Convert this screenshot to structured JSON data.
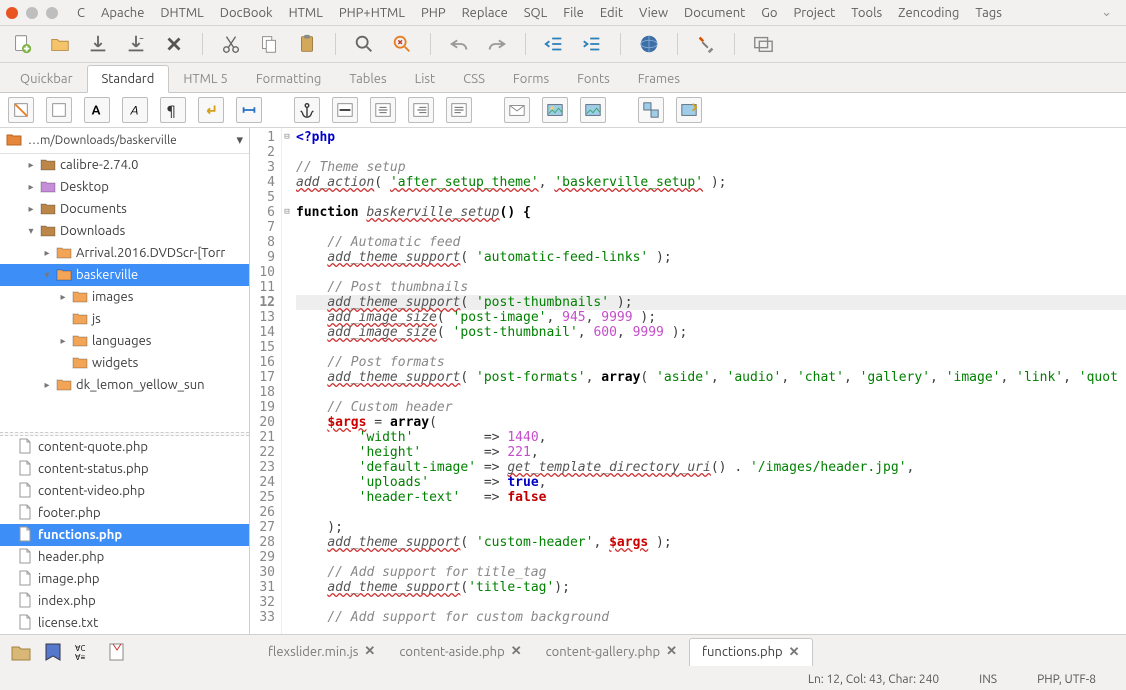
{
  "menu": [
    "C",
    "Apache",
    "DHTML",
    "DocBook",
    "HTML",
    "PHP+HTML",
    "PHP",
    "Replace",
    "SQL",
    "File",
    "Edit",
    "View",
    "Document",
    "Go",
    "Project",
    "Tools",
    "Zencoding",
    "Tags"
  ],
  "toolbar_tabs": [
    "Quickbar",
    "Standard",
    "HTML 5",
    "Formatting",
    "Tables",
    "List",
    "CSS",
    "Forms",
    "Fonts",
    "Frames"
  ],
  "active_toolbar_tab": 1,
  "sidebar": {
    "path": "…m/Downloads/baskerville",
    "tree": [
      {
        "indent": 1,
        "expander": "▸",
        "icon": "folder-brown",
        "label": "calibre-2.74.0"
      },
      {
        "indent": 1,
        "expander": "▸",
        "icon": "folder-purple",
        "label": "Desktop"
      },
      {
        "indent": 1,
        "expander": "▸",
        "icon": "folder-brown",
        "label": "Documents"
      },
      {
        "indent": 1,
        "expander": "▾",
        "icon": "folder-brown",
        "label": "Downloads"
      },
      {
        "indent": 2,
        "expander": "▸",
        "icon": "folder",
        "label": "Arrival.2016.DVDScr-[Torr"
      },
      {
        "indent": 2,
        "expander": "▾",
        "icon": "folder",
        "label": "baskerville",
        "selected": true
      },
      {
        "indent": 3,
        "expander": "▸",
        "icon": "folder",
        "label": "images"
      },
      {
        "indent": 3,
        "expander": "",
        "icon": "folder",
        "label": "js"
      },
      {
        "indent": 3,
        "expander": "▸",
        "icon": "folder",
        "label": "languages"
      },
      {
        "indent": 3,
        "expander": "",
        "icon": "folder",
        "label": "widgets"
      },
      {
        "indent": 2,
        "expander": "▸",
        "icon": "folder",
        "label": "dk_lemon_yellow_sun"
      }
    ],
    "files": [
      {
        "label": "content-quote.php"
      },
      {
        "label": "content-status.php"
      },
      {
        "label": "content-video.php"
      },
      {
        "label": "footer.php"
      },
      {
        "label": "functions.php",
        "selected": true
      },
      {
        "label": "header.php"
      },
      {
        "label": "image.php"
      },
      {
        "label": "index.php"
      },
      {
        "label": "license.txt"
      }
    ]
  },
  "doc_tabs": [
    {
      "label": "flexslider.min.js",
      "close": true
    },
    {
      "label": "content-aside.php",
      "close": true
    },
    {
      "label": "content-gallery.php",
      "close": true
    },
    {
      "label": "functions.php",
      "close": true,
      "active": true
    }
  ],
  "status": {
    "pos": "Ln: 12, Col: 43, Char: 240",
    "mode": "INS",
    "enc": "PHP, UTF-8"
  },
  "code_lines": 33,
  "current_line": 12
}
